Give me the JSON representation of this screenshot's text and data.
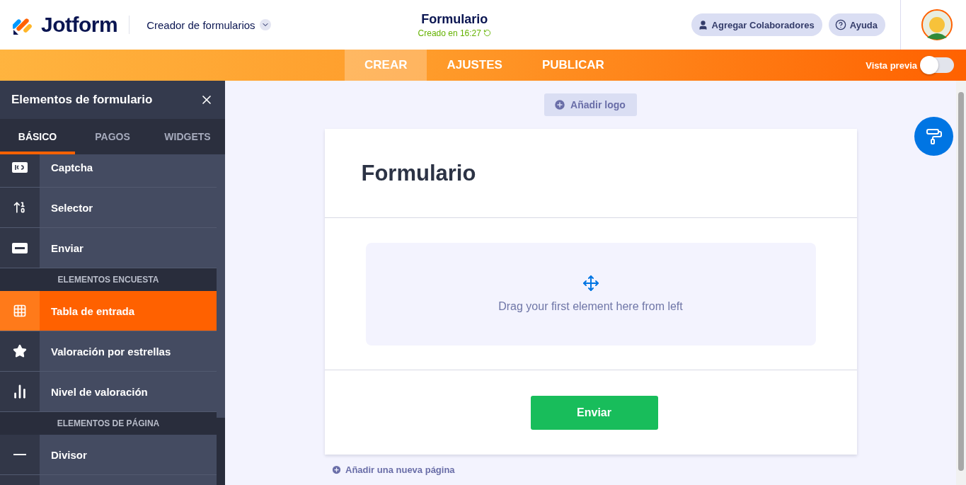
{
  "header": {
    "logo": "Jotform",
    "product_menu": "Creador de formularios",
    "title": "Formulario",
    "saved_status": "Creado en 16:27",
    "buttons": [
      {
        "label": "Agregar Colaboradores",
        "kind": "user"
      },
      {
        "label": "Ayuda",
        "kind": "help"
      }
    ]
  },
  "nav": {
    "tabs": [
      {
        "label": "CREAR",
        "selected": true
      },
      {
        "label": "AJUSTES",
        "selected": false
      },
      {
        "label": "PUBLICAR",
        "selected": false
      }
    ],
    "preview": {
      "label": "Vista previa",
      "on": false
    }
  },
  "sidebar": {
    "title": "Elementos de formulario",
    "tabs": [
      {
        "label": "BÁSICO",
        "selected": true
      },
      {
        "label": "PAGOS",
        "selected": false
      },
      {
        "label": "WIDGETS",
        "selected": false
      }
    ],
    "items": [
      {
        "kind": "item",
        "label": "Captcha",
        "selected": false
      },
      {
        "kind": "item",
        "label": "Selector",
        "selected": false
      },
      {
        "kind": "item",
        "label": "Enviar",
        "selected": false
      },
      {
        "kind": "section",
        "label": "ELEMENTOS ENCUESTA"
      },
      {
        "kind": "item",
        "label": "Tabla de entrada",
        "selected": true
      },
      {
        "kind": "item",
        "label": "Valoración por estrellas",
        "selected": false
      },
      {
        "kind": "item",
        "label": "Nivel de valoración",
        "selected": false
      },
      {
        "kind": "section",
        "label": "ELEMENTOS DE PÁGINA"
      },
      {
        "kind": "item",
        "label": "Divisor",
        "selected": false
      }
    ]
  },
  "canvas": {
    "add_logo": "Añadir logo",
    "form_title": "Formulario",
    "drop_hint": "Drag your first element here from left",
    "submit": "Enviar",
    "add_page": "Añadir una nueva página"
  }
}
